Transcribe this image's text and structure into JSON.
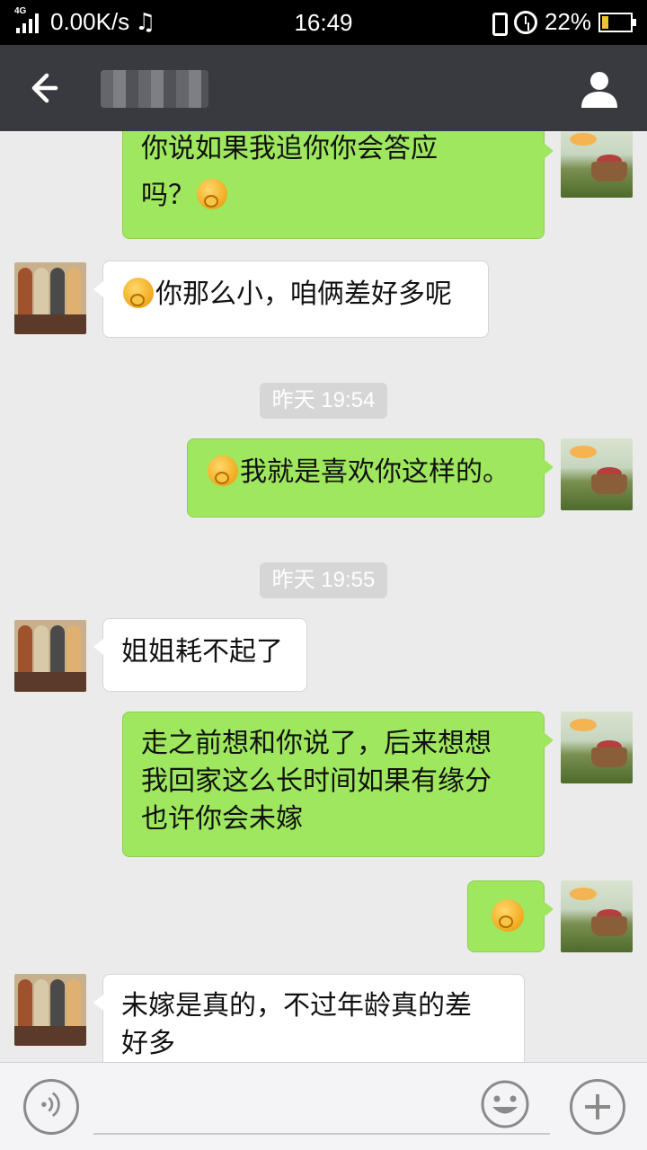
{
  "status_bar": {
    "network": "4G",
    "speed": "0.00K/s",
    "music_icon": "♫",
    "time": "16:49",
    "battery": "22%",
    "battery_level": 0.22
  },
  "header": {
    "back_icon": "arrow-left-icon",
    "contact_name": "",
    "profile_icon": "person-icon"
  },
  "messages": [
    {
      "side": "right",
      "text_before": "你说如果我追你你会答应",
      "text_line2": "吗？",
      "emoji_after": true
    },
    {
      "side": "left",
      "text": "你那么小，咱俩差好多呢",
      "emoji_before": true
    },
    {
      "type": "time",
      "text": "昨天 19:54"
    },
    {
      "side": "right",
      "text": "我就是喜欢你这样的。",
      "emoji_before": true
    },
    {
      "type": "time",
      "text": "昨天 19:55"
    },
    {
      "side": "left",
      "text": "姐姐耗不起了"
    },
    {
      "side": "right",
      "lines": [
        "走之前想和你说了，后来想想",
        "我回家这么长时间如果有缘分",
        "也许你会未嫁"
      ]
    },
    {
      "side": "right",
      "emoji_only": true
    },
    {
      "side": "left",
      "lines": [
        "未嫁是真的，不过年龄真的差",
        "好多"
      ]
    }
  ],
  "input_bar": {
    "voice_icon": "voice-icon",
    "emoji_icon": "smiley-icon",
    "plus_icon": "plus-icon"
  },
  "colors": {
    "title_bar": "#393a3f",
    "bubble_self": "#9fe75e",
    "bubble_other": "#ffffff",
    "background": "#ebebeb"
  }
}
